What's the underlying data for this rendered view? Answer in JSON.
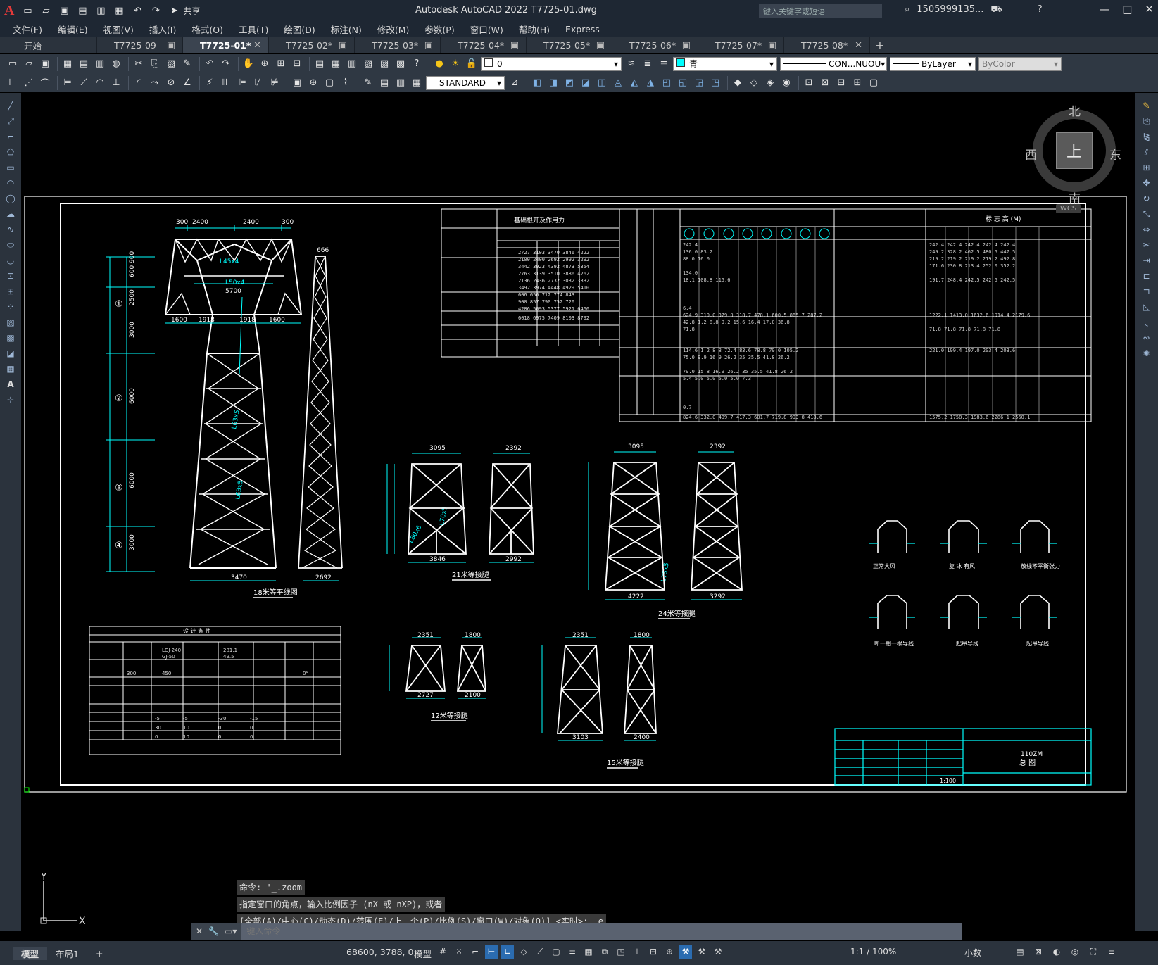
{
  "title": {
    "app_logo": "A",
    "text": "Autodesk AutoCAD 2022    T7725-01.dwg",
    "search_placeholder": "键入关键字或短语",
    "user": "1505999135...",
    "share_label": "共享"
  },
  "menu": [
    "文件(F)",
    "编辑(E)",
    "视图(V)",
    "插入(I)",
    "格式(O)",
    "工具(T)",
    "绘图(D)",
    "标注(N)",
    "修改(M)",
    "参数(P)",
    "窗口(W)",
    "帮助(H)",
    "Express"
  ],
  "tabs": [
    {
      "label": "开始",
      "active": false,
      "closable": false
    },
    {
      "label": "T7725-09",
      "active": false,
      "closable": true
    },
    {
      "label": "T7725-01*",
      "active": true,
      "closable": true
    },
    {
      "label": "T7725-02*",
      "active": false,
      "closable": true
    },
    {
      "label": "T7725-03*",
      "active": false,
      "closable": true
    },
    {
      "label": "T7725-04*",
      "active": false,
      "closable": true
    },
    {
      "label": "T7725-05*",
      "active": false,
      "closable": true
    },
    {
      "label": "T7725-06*",
      "active": false,
      "closable": true
    },
    {
      "label": "T7725-07*",
      "active": false,
      "closable": true
    },
    {
      "label": "T7725-08*",
      "active": false,
      "closable": true
    }
  ],
  "toolbar1": {
    "layer_value": "0",
    "color_value": "青",
    "color_swatch": "#00ffff",
    "linetype_value": "CON...NUOU",
    "lineweight_value": "ByLayer",
    "plotstyle_value": "ByColor"
  },
  "toolbar2": {
    "textstyle_value": "STANDARD"
  },
  "viewcube": {
    "north": "北",
    "south": "南",
    "east": "东",
    "west": "西",
    "top": "上",
    "wcs": "WCS"
  },
  "drawing": {
    "tower_label_18": "18米等平线图",
    "tower_label_21": "21米等接腿",
    "tower_label_24": "24米等接腿",
    "tower_label_12": "12米等接腿",
    "tower_label_15": "15米等接腿",
    "table1_title": "基础根开及作用力",
    "table2_title": "标  志  高  (M)",
    "design_table_title": "设  计  条  件",
    "title_block_project": "110ZM",
    "title_block_name": "总  图",
    "title_block_scale": "1:100",
    "dims_18": [
      "300",
      "2400",
      "2400",
      "300",
      "5700",
      "1600",
      "1918",
      "1918",
      "1600",
      "3470",
      "2692",
      "666"
    ],
    "dims_21": [
      "3095",
      "2392",
      "3846",
      "2992"
    ],
    "dims_24": [
      "3095",
      "2392",
      "4222",
      "3292"
    ],
    "dims_12": [
      "2351",
      "1800",
      "2727",
      "2100"
    ],
    "dims_15": [
      "2351",
      "1800",
      "3103",
      "2400"
    ],
    "height_marks": [
      "600 900",
      "2500",
      "3000",
      "6000",
      "6000",
      "3000"
    ],
    "segment_ids": [
      "①",
      "②",
      "③",
      "④"
    ],
    "detail_labels": [
      "正常大风",
      "复 冰 有风",
      "放线不平衡张力",
      "断一相一根导线",
      "起吊导线",
      "起吊导线"
    ],
    "member_labels": [
      "L45x4",
      "L50x4",
      "L63x5",
      "L63x5",
      "L70x5",
      "L75x5",
      "L80x6"
    ]
  },
  "command": {
    "history": [
      "命令: '_.zoom",
      "指定窗口的角点，输入比例因子 (nX 或 nXP)，或者",
      "[全部(A)/中心(C)/动态(D)/范围(E)/上一个(P)/比例(S)/窗口(W)/对象(O)] <实时>: _e"
    ],
    "placeholder": "键入命令"
  },
  "status": {
    "layout_tabs": [
      "模型",
      "布局1"
    ],
    "coords": "68600, 3788, 0",
    "space": "模型",
    "scale": "1:1 / 100%",
    "units": "小数"
  }
}
